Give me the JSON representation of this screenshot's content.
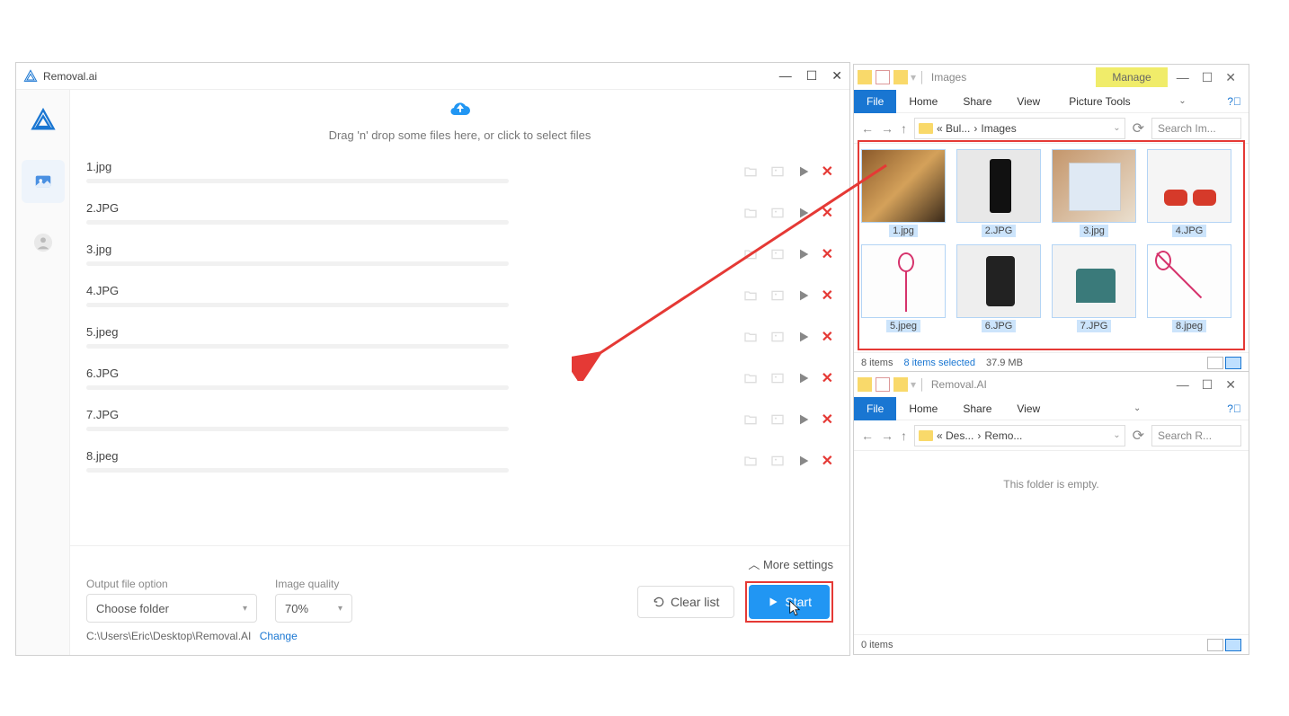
{
  "app": {
    "title": "Removal.ai",
    "upload_hint": "Drag 'n' drop some files here, or click to select files",
    "files": [
      {
        "name": "1.jpg"
      },
      {
        "name": "2.JPG"
      },
      {
        "name": "3.jpg"
      },
      {
        "name": "4.JPG"
      },
      {
        "name": "5.jpeg"
      },
      {
        "name": "6.JPG"
      },
      {
        "name": "7.JPG"
      },
      {
        "name": "8.jpeg"
      }
    ],
    "more_settings": "More settings",
    "output_label": "Output file option",
    "output_select": "Choose folder",
    "quality_label": "Image quality",
    "quality_select": "70%",
    "output_path": "C:\\Users\\Eric\\Desktop\\Removal.AI",
    "change": "Change",
    "clear": "Clear list",
    "start": "Start"
  },
  "explorer1": {
    "title": "Images",
    "manage": "Manage",
    "tabs": {
      "file": "File",
      "home": "Home",
      "share": "Share",
      "view": "View",
      "picture": "Picture Tools"
    },
    "addr1": "« Bul...",
    "addr2": "Images",
    "search": "Search Im...",
    "thumbs": [
      "1.jpg",
      "2.JPG",
      "3.jpg",
      "4.JPG",
      "5.jpeg",
      "6.JPG",
      "7.JPG",
      "8.jpeg"
    ],
    "status_count": "8 items",
    "status_sel": "8 items selected",
    "status_size": "37.9 MB"
  },
  "explorer2": {
    "title": "Removal.AI",
    "tabs": {
      "file": "File",
      "home": "Home",
      "share": "Share",
      "view": "View"
    },
    "addr1": "« Des...",
    "addr2": "Remo...",
    "search": "Search R...",
    "empty": "This folder is empty.",
    "status_count": "0 items"
  }
}
